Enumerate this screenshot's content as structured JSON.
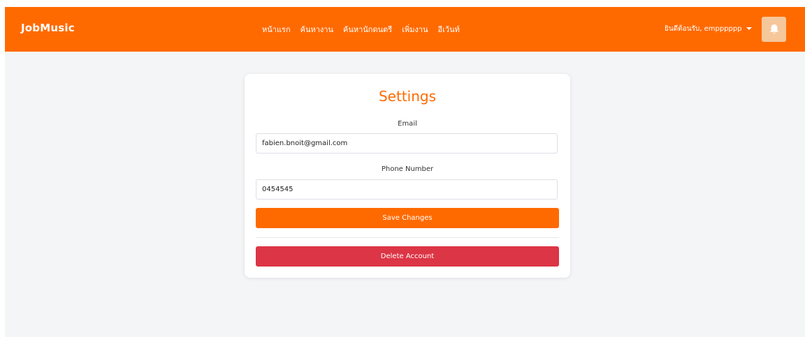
{
  "navbar": {
    "brand": "JobMusic",
    "links": [
      {
        "label": "หน้าแรก"
      },
      {
        "label": "ค้นหางาน"
      },
      {
        "label": "ค้นหานักดนตรี"
      },
      {
        "label": "เพิ่มงาน"
      },
      {
        "label": "อีเว้นท์"
      }
    ],
    "user_greeting": "ยินดีต้อนรับ, empppppp",
    "bell_icon": "bell-icon"
  },
  "settings": {
    "title": "Settings",
    "email_label": "Email",
    "email_value": "fabien.bnoit@gmail.com",
    "phone_label": "Phone Number",
    "phone_value": "0454545",
    "save_label": "Save Changes",
    "delete_label": "Delete Account"
  },
  "colors": {
    "accent": "#ff6a00",
    "danger": "#dc3545",
    "bell_button_bg": "#f6c79a",
    "page_bg": "#f4f5f7"
  }
}
